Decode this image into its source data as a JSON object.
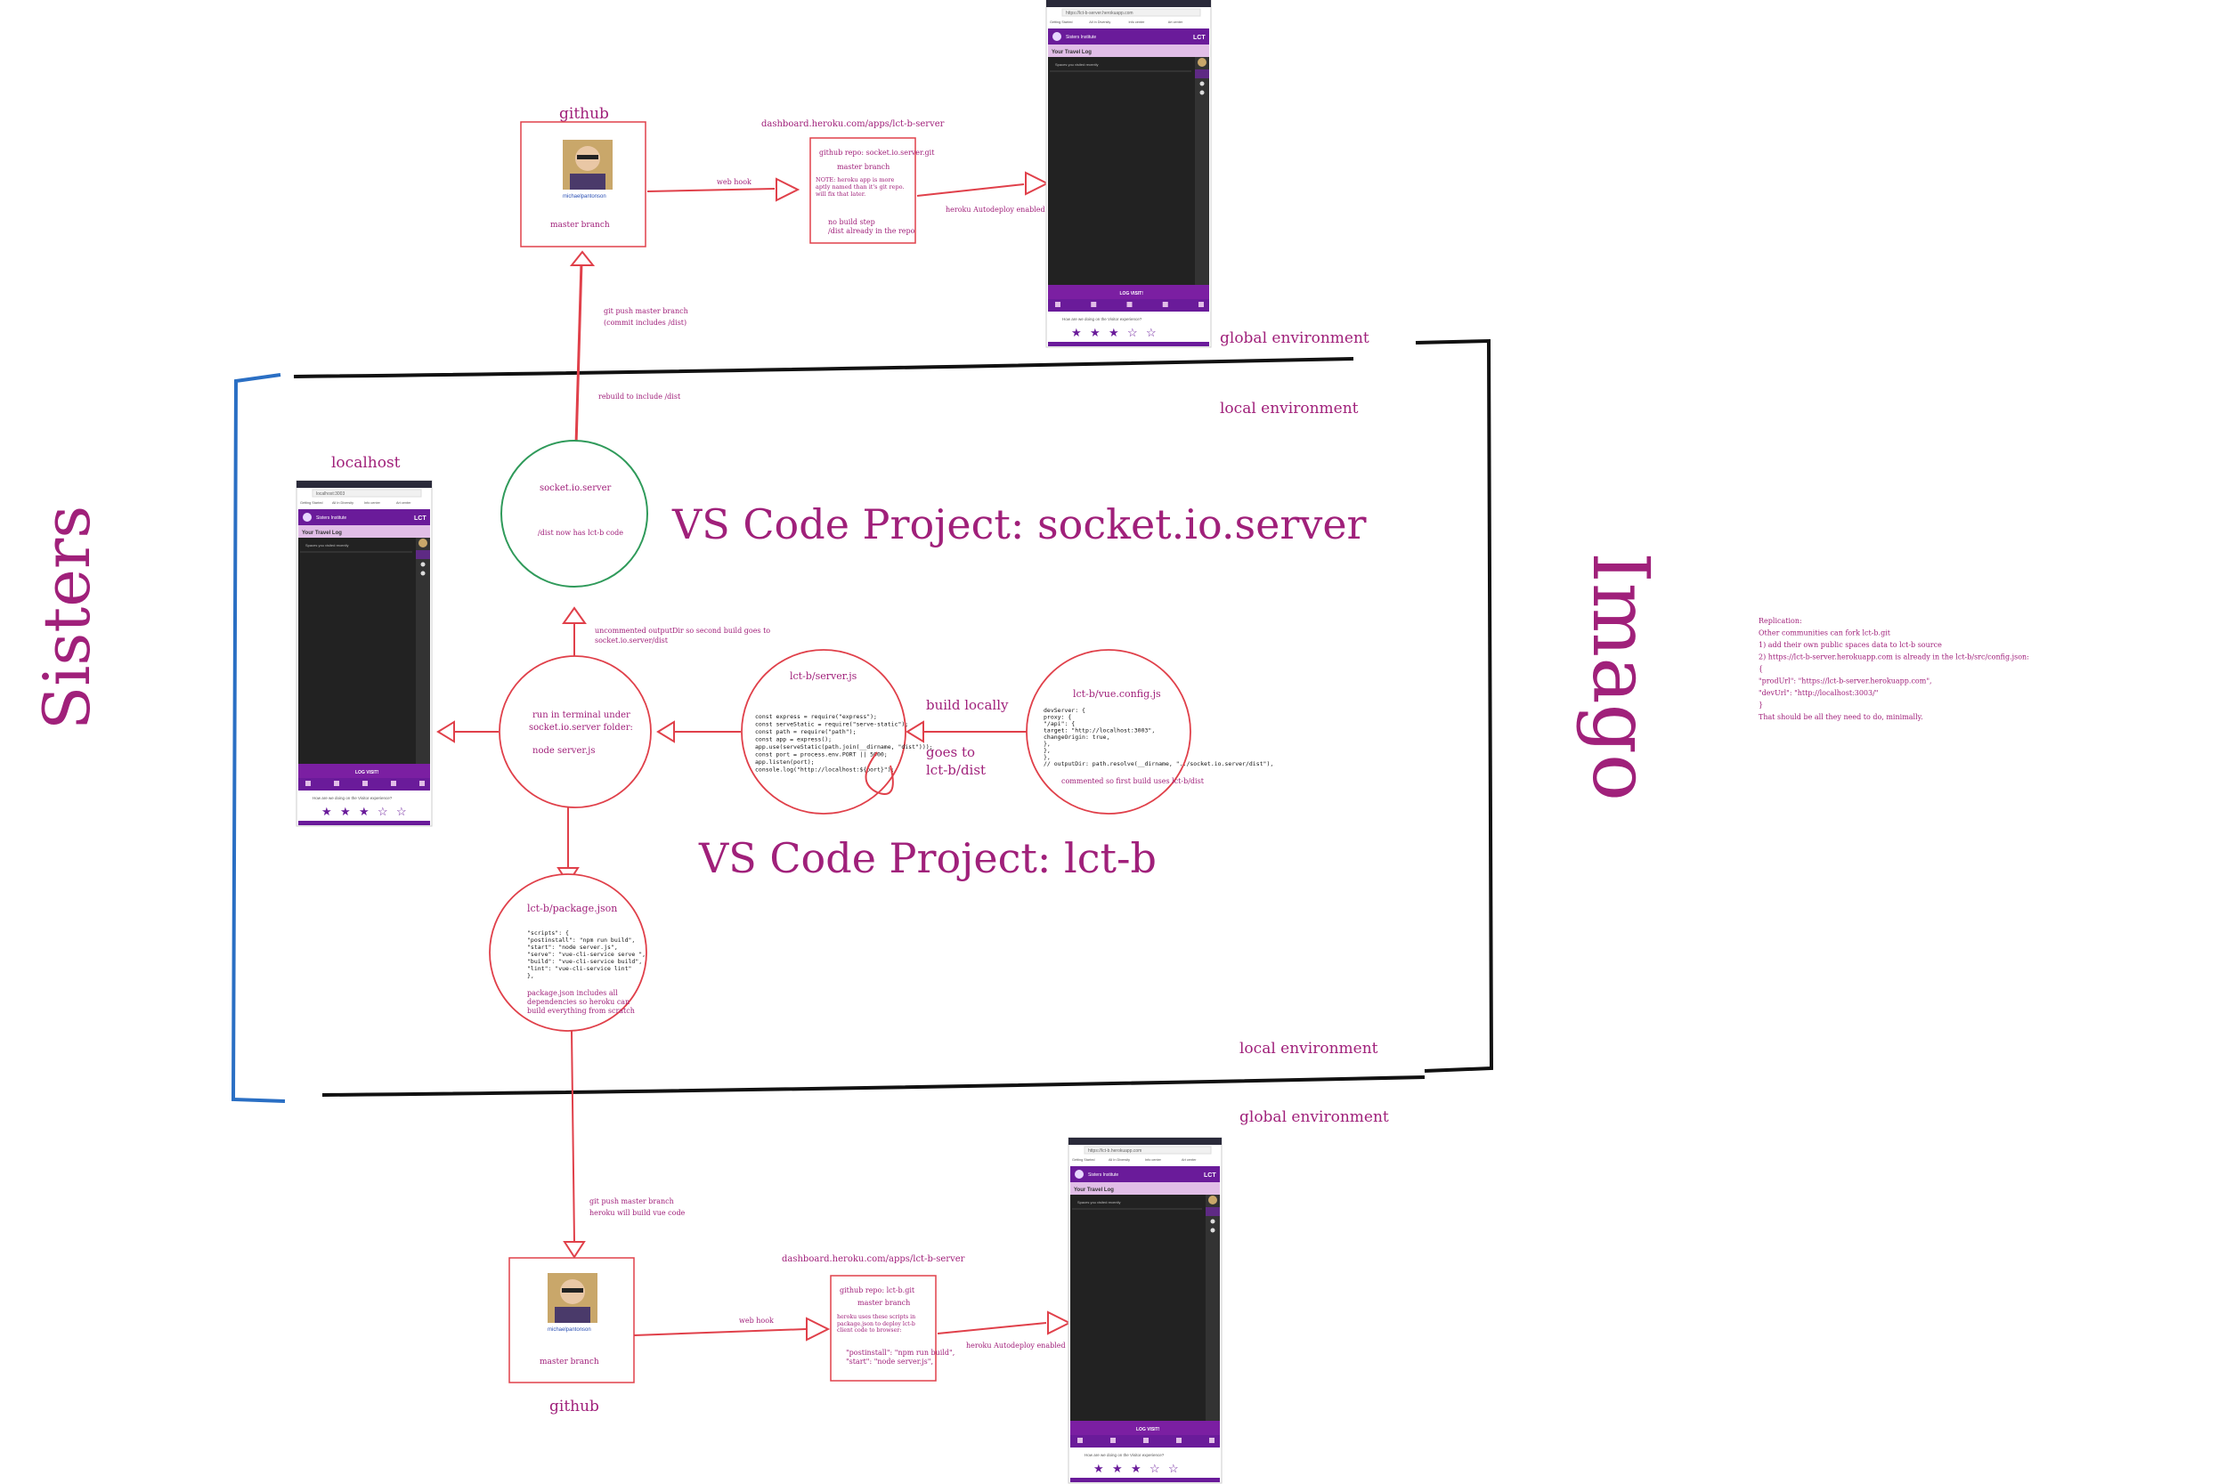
{
  "colors": {
    "ink": "#a0207a",
    "red": "#e0404a",
    "green": "#2f9a5a",
    "blue": "#2a6fc4",
    "black": "#111111",
    "app_purple": "#6a1b9a",
    "app_light": "#e1bee7"
  },
  "labels": {
    "sisters": "Sisters",
    "imago": "Imago",
    "vs_socket": "VS Code Project: socket.io.server",
    "vs_lct": "VS Code Project: lct-b",
    "global_env_top": "global environment",
    "local_env_top": "local environment",
    "local_env_bottom": "local environment",
    "global_env_bottom": "global environment",
    "localhost": "localhost"
  },
  "top_flow": {
    "github_title": "github",
    "github_branch": "master branch",
    "github_user": "michaelpantonson",
    "webhook": "web hook",
    "dashboard_url": "dashboard.heroku.com/apps/lct-b-server",
    "heroku_lines": [
      "github repo: socket.io.server.git",
      "master branch",
      "NOTE: heroku app is more aptly named than it's git repo. will fix that later.",
      "no build step",
      "/dist already in the repo"
    ],
    "autodeploy": "heroku Autodeploy enabled",
    "push_note_1": "git push master branch",
    "push_note_2": "(commit includes /dist)",
    "rebuild_note": "rebuild to include /dist"
  },
  "socket_circle": {
    "title": "socket.io.server",
    "note": "/dist now has lct-b code"
  },
  "middle": {
    "uncommented_1": "uncommented outputDir so second build goes to",
    "uncommented_2": "socket.io.server/dist",
    "run_1": "run in terminal under",
    "run_2": "socket.io.server folder:",
    "run_3": "node server.js",
    "server_title": "lct-b/server.js",
    "server_code": [
      "const express = require(\"express\");",
      "const serveStatic = require(\"serve-static\");",
      "const path = require(\"path\");",
      "const app = express();",
      "app.use(serveStatic(path.join(__dirname, \"dist\")));",
      "const port = process.env.PORT || 5000;",
      "app.listen(port);",
      "console.log(\"http://localhost:${port}\");"
    ],
    "build_locally": "build locally",
    "goes_to_1": "goes to",
    "goes_to_2": "lct-b/dist",
    "vue_title": "lct-b/vue.config.js",
    "vue_code": [
      "devServer: {",
      "  proxy: {",
      "    \"/api\": {",
      "      target: \"http://localhost:3003\",",
      "      changeOrigin: true,",
      "    },",
      "  },",
      "},",
      "// outputDir: path.resolve(__dirname, \"../socket.io.server/dist\"),"
    ],
    "vue_note": "commented so first build uses lct-b/dist",
    "pkg_title": "lct-b/package.json",
    "pkg_code": [
      "\"scripts\": {",
      "  \"postinstall\": \"npm run build\",",
      "  \"start\": \"node server.js\",",
      "  \"serve\": \"vue-cli-service serve \",",
      "  \"build\": \"vue-cli-service build\",",
      "  \"lint\": \"vue-cli-service lint\"",
      "},"
    ],
    "pkg_note": [
      "package.json includes all",
      "dependencies so heroku can",
      "build everything from scratch"
    ]
  },
  "bottom_flow": {
    "push_1": "git push master branch",
    "push_2": "heroku will build vue code",
    "github_title": "github",
    "github_branch": "master branch",
    "github_user": "michaelpantonson",
    "webhook": "web hook",
    "dashboard_url": "dashboard.heroku.com/apps/lct-b-server",
    "heroku_lines": [
      "github repo: lct-b.git",
      "master branch",
      "heroku uses these scripts in package.json to deploy lct-b client code to browser:",
      "\"postinstall\": \"npm run build\",",
      "\"start\": \"node server.js\","
    ],
    "autodeploy": "heroku Autodeploy enabled"
  },
  "replication": {
    "lines": [
      "Replication:",
      "Other communities can fork lct-b.git",
      "  1) add their own public spaces data to lct-b source",
      "  2) https://lct-b-server.herokuapp.com is already in the lct-b/src/config.json:",
      "      {",
      "        \"prodUrl\": \"https://lct-b-server.herokuapp.com\",",
      "        \"devUrl\": \"http://localhost:3003/\"",
      "      }",
      "That should be all they need to do, minimally."
    ]
  },
  "app": {
    "brand": "Sisters Institute",
    "short": "LCT",
    "panel_title": "Your Travel Log",
    "panel_hint": "Spaces you visited recently",
    "log_visit": "LOG VISIT!",
    "feedback": "How are we doing on the Visitor experience?",
    "stars": [
      "★",
      "★",
      "★",
      "☆",
      "☆"
    ],
    "tabs": [
      "Getting Started",
      "All In Diversity",
      "Info center",
      "Art center"
    ],
    "url_top": "https://lct-b-server.herokuapp.com",
    "url_local": "localhost:3003",
    "url_bottom": "https://lct-b.herokuapp.com"
  }
}
